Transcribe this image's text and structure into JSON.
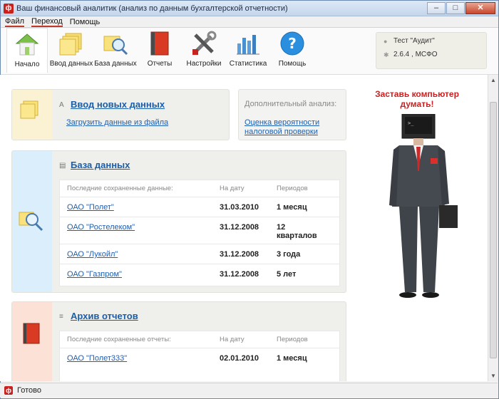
{
  "window": {
    "title": "Ваш финансовый аналитик (анализ по данным бухгалтерской отчетности)",
    "minimize": "–",
    "maximize": "□",
    "close": "✕"
  },
  "menu": [
    {
      "label": "Файл"
    },
    {
      "label": "Переход"
    },
    {
      "label": "Помощь"
    }
  ],
  "toolbar": [
    {
      "label": "Начало",
      "icon": "home-icon"
    },
    {
      "label": "Ввод данных",
      "icon": "notes-icon"
    },
    {
      "label": "База данных",
      "icon": "database-search-icon"
    },
    {
      "label": "Отчеты",
      "icon": "book-icon"
    },
    {
      "label": "Настройки",
      "icon": "tools-icon"
    },
    {
      "label": "Статистика",
      "icon": "chart-icon"
    },
    {
      "label": "Помощь",
      "icon": "help-icon"
    }
  ],
  "user": {
    "name": "Тест \"Аудит\"",
    "version": "2.6.4 , МСФО"
  },
  "input_panel": {
    "title": "Ввод новых данных",
    "link": "Загрузить данные из файла"
  },
  "extra_panel": {
    "title": "Дополнительный анализ:",
    "link_line1": "Оценка вероятности",
    "link_line2": "налоговой проверки"
  },
  "db_panel": {
    "title": "База данных",
    "headers": [
      "Последние сохраненные данные:",
      "На дату",
      "Периодов"
    ],
    "rows": [
      {
        "name": "ОАО \"Полет\"",
        "date": "31.03.2010",
        "periods": "1 месяц"
      },
      {
        "name": "ОАО \"Ростелеком\"",
        "date": "31.12.2008",
        "periods": "12 кварталов"
      },
      {
        "name": "ОАО \"Лукойл\"",
        "date": "31.12.2008",
        "periods": "3 года"
      },
      {
        "name": "ОАО \"Газпром\"",
        "date": "31.12.2008",
        "periods": "5 лет"
      }
    ]
  },
  "archive_panel": {
    "title": "Архив отчетов",
    "headers": [
      "Последние сохраненные отчеты:",
      "На дату",
      "Периодов"
    ],
    "rows": [
      {
        "name": "ОАО \"Полет333\"",
        "date": "02.01.2010",
        "periods": "1 месяц"
      }
    ]
  },
  "promo": {
    "line1": "Заставь компьютер",
    "line2": "думать!"
  },
  "status": {
    "text": "Готово"
  }
}
